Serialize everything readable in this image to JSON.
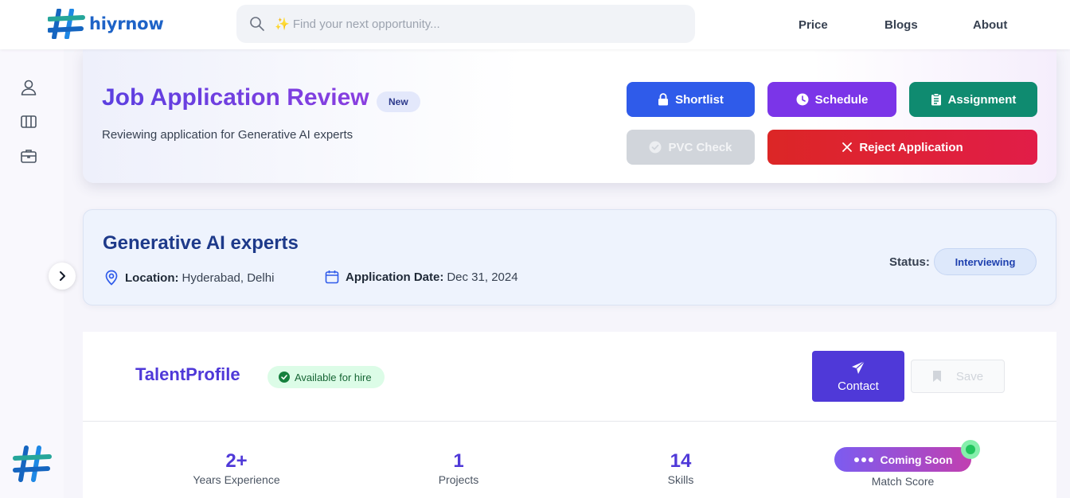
{
  "header": {
    "logo_text": "hiyrnow",
    "search_placeholder": "✨ Find your next opportunity...",
    "nav": [
      "Price",
      "Blogs",
      "About"
    ]
  },
  "sidebar": {
    "icons": [
      "user-icon",
      "columns-icon",
      "briefcase-icon"
    ]
  },
  "review": {
    "title": "Job Application Review",
    "badge": "New",
    "subtitle": "Reviewing application for Generative AI experts",
    "buttons": {
      "shortlist": "Shortlist",
      "schedule": "Schedule",
      "assignment": "Assignment",
      "pvc_check": "PVC Check",
      "reject": "Reject Application"
    }
  },
  "job": {
    "title": "Generative AI experts",
    "location_label": "Location:",
    "location_value": "Hyderabad, Delhi",
    "date_label": "Application Date:",
    "date_value": "Dec 31, 2024",
    "status_label": "Status:",
    "status_value": "Interviewing"
  },
  "talent": {
    "title": "TalentProfile",
    "availability": "Available for hire",
    "contact_label": "Contact",
    "save_label": "Save",
    "stats": [
      {
        "value": "2+",
        "label": "Years Experience"
      },
      {
        "value": "1",
        "label": "Projects"
      },
      {
        "value": "14",
        "label": "Skills"
      }
    ],
    "match": {
      "badge": "Coming Soon",
      "label": "Match Score"
    }
  },
  "colors": {
    "primary": "#4f39d8",
    "shortlist": "#2f5bea",
    "schedule": "#7b35e8",
    "assignment": "#0f8b70",
    "reject": "#dc2626"
  }
}
